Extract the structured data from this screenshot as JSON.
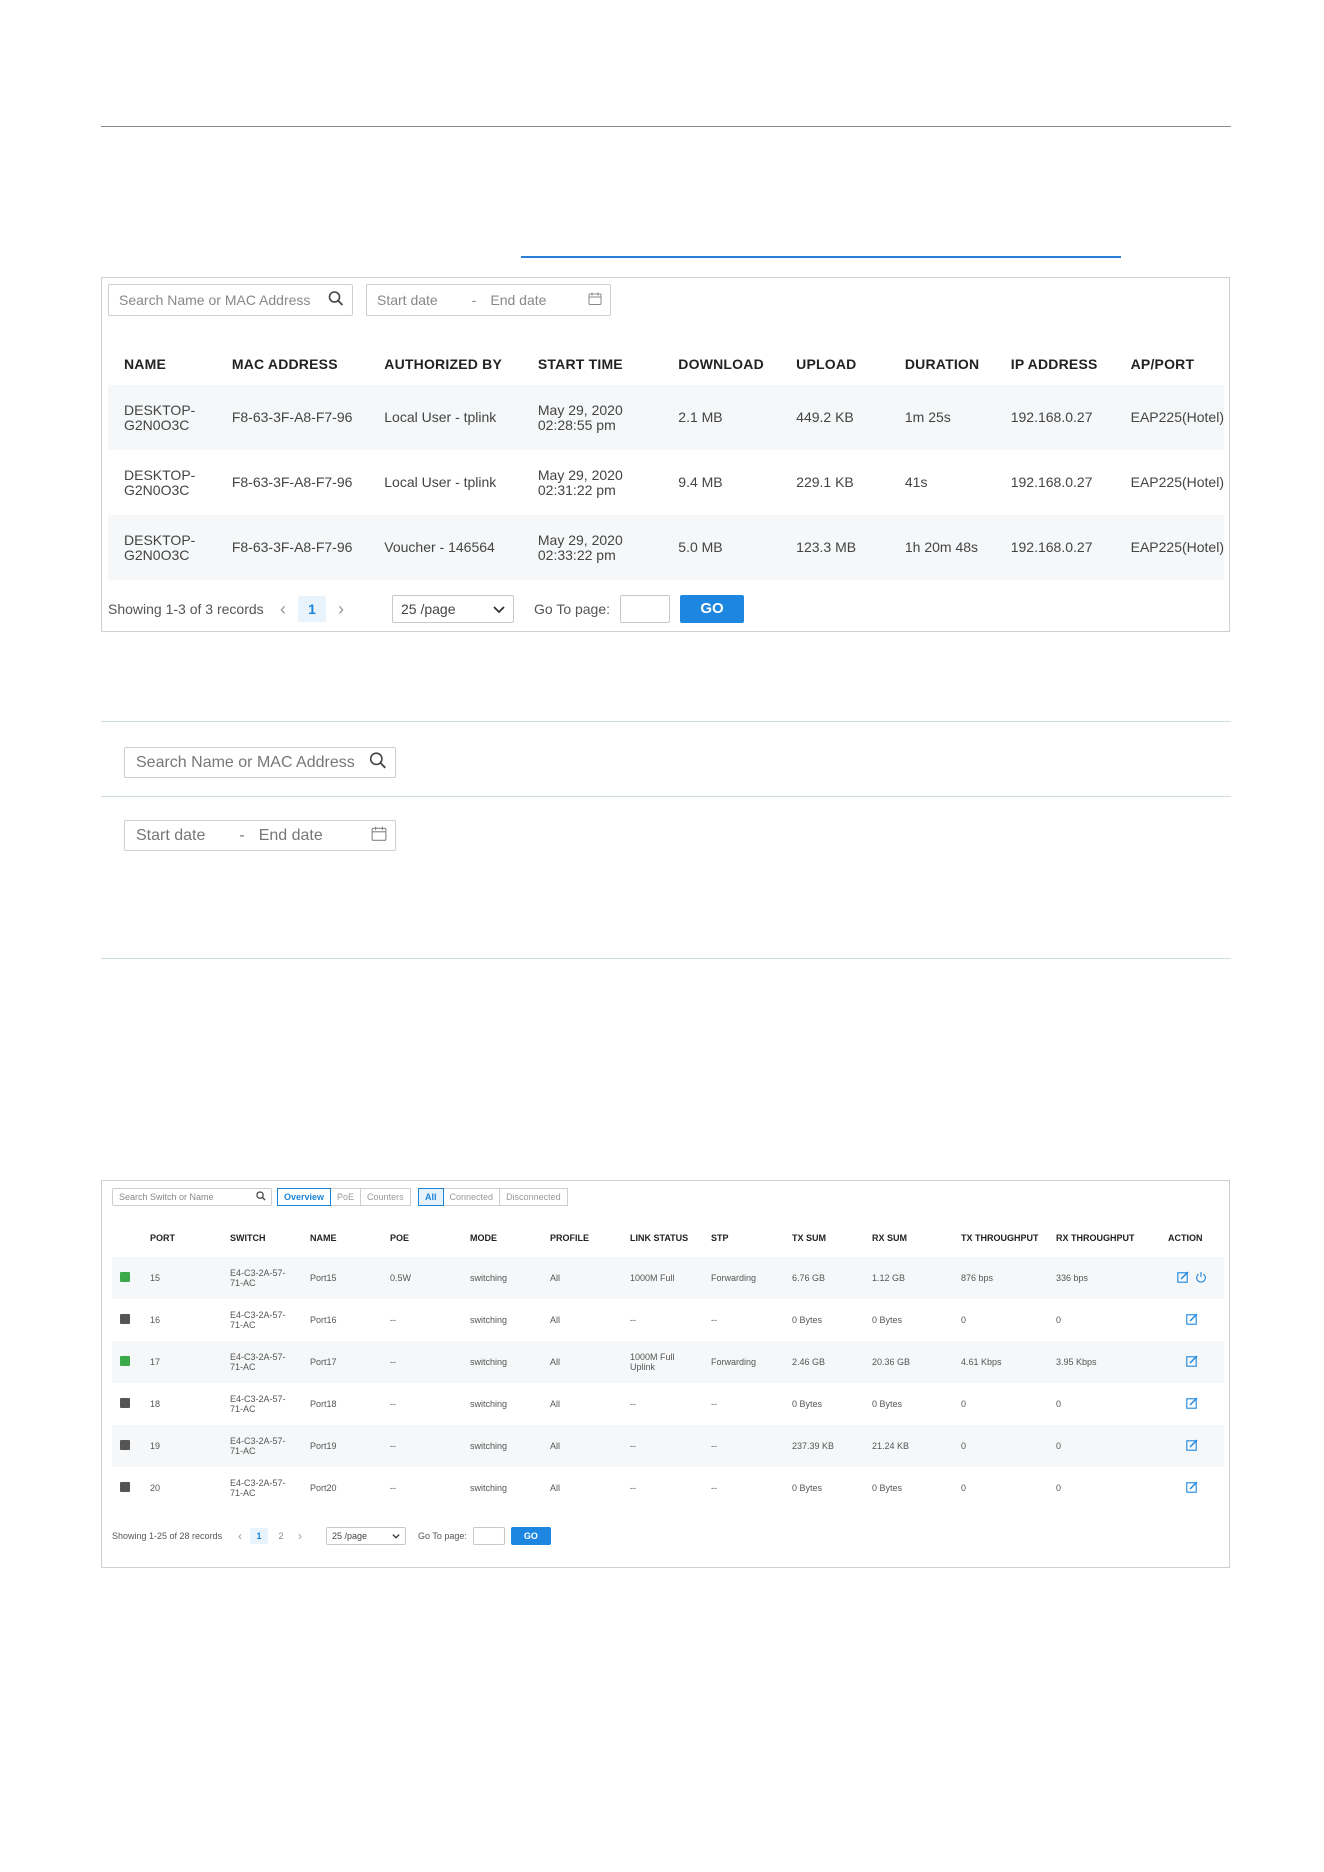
{
  "panel1": {
    "search_placeholder": "Search Name or MAC Address",
    "date_start": "Start date",
    "date_sep": "-",
    "date_end": "End date",
    "columns": [
      "NAME",
      "MAC ADDRESS",
      "AUTHORIZED BY",
      "START TIME",
      "DOWNLOAD",
      "UPLOAD",
      "DURATION",
      "IP ADDRESS",
      "AP/PORT"
    ],
    "rows": [
      {
        "name1": "DESKTOP-",
        "name2": "G2N0O3C",
        "mac": "F8-63-3F-A8-F7-96",
        "auth": "Local User - tplink",
        "time1": "May 29, 2020",
        "time2": "02:28:55 pm",
        "download": "2.1 MB",
        "upload": "449.2 KB",
        "duration": "1m 25s",
        "ip": "192.168.0.27",
        "ap": "EAP225(Hotel)"
      },
      {
        "name1": "DESKTOP-",
        "name2": "G2N0O3C",
        "mac": "F8-63-3F-A8-F7-96",
        "auth": "Local User - tplink",
        "time1": "May 29, 2020",
        "time2": "02:31:22 pm",
        "download": "9.4 MB",
        "upload": "229.1 KB",
        "duration": "41s",
        "ip": "192.168.0.27",
        "ap": "EAP225(Hotel)"
      },
      {
        "name1": "DESKTOP-",
        "name2": "G2N0O3C",
        "mac": "F8-63-3F-A8-F7-96",
        "auth": "Voucher - 146564",
        "time1": "May 29, 2020",
        "time2": "02:33:22 pm",
        "download": "5.0 MB",
        "upload": "123.3 MB",
        "duration": "1h 20m 48s",
        "ip": "192.168.0.27",
        "ap": "EAP225(Hotel)"
      }
    ],
    "pager": {
      "showing": "Showing 1-3 of 3 records",
      "page": "1",
      "per_page": "25 /page",
      "goto_label": "Go To page:",
      "go": "GO"
    }
  },
  "standalone": {
    "search_placeholder": "Search Name or MAC Address",
    "date_start": "Start date",
    "date_sep": "-",
    "date_end": "End date"
  },
  "panel2": {
    "search_placeholder": "Search Switch or Name",
    "view_tabs": [
      "Overview",
      "PoE",
      "Counters"
    ],
    "status_tabs": [
      "All",
      "Connected",
      "Disconnected"
    ],
    "columns": [
      "PORT",
      "SWITCH",
      "NAME",
      "POE",
      "MODE",
      "PROFILE",
      "LINK STATUS",
      "STP",
      "TX SUM",
      "RX SUM",
      "TX THROUGHPUT",
      "RX THROUGHPUT",
      "ACTION"
    ],
    "rows": [
      {
        "status": "up",
        "port": "15",
        "sw1": "E4-C3-2A-57-",
        "sw2": "71-AC",
        "name": "Port15",
        "poe": "0.5W",
        "mode": "switching",
        "profile": "All",
        "link1": "1000M Full",
        "link2": "",
        "stp": "Forwarding",
        "tx": "6.76 GB",
        "rx": "1.12 GB",
        "txt": "876 bps",
        "rxt": "336 bps",
        "power": true
      },
      {
        "status": "down",
        "port": "16",
        "sw1": "E4-C3-2A-57-",
        "sw2": "71-AC",
        "name": "Port16",
        "poe": "--",
        "mode": "switching",
        "profile": "All",
        "link1": "--",
        "link2": "",
        "stp": "--",
        "tx": "0 Bytes",
        "rx": "0 Bytes",
        "txt": "0",
        "rxt": "0",
        "power": false
      },
      {
        "status": "up",
        "port": "17",
        "sw1": "E4-C3-2A-57-",
        "sw2": "71-AC",
        "name": "Port17",
        "poe": "--",
        "mode": "switching",
        "profile": "All",
        "link1": "1000M Full",
        "link2": "Uplink",
        "stp": "Forwarding",
        "tx": "2.46 GB",
        "rx": "20.36 GB",
        "txt": "4.61 Kbps",
        "rxt": "3.95 Kbps",
        "power": false
      },
      {
        "status": "down",
        "port": "18",
        "sw1": "E4-C3-2A-57-",
        "sw2": "71-AC",
        "name": "Port18",
        "poe": "--",
        "mode": "switching",
        "profile": "All",
        "link1": "--",
        "link2": "",
        "stp": "--",
        "tx": "0 Bytes",
        "rx": "0 Bytes",
        "txt": "0",
        "rxt": "0",
        "power": false
      },
      {
        "status": "down",
        "port": "19",
        "sw1": "E4-C3-2A-57-",
        "sw2": "71-AC",
        "name": "Port19",
        "poe": "--",
        "mode": "switching",
        "profile": "All",
        "link1": "--",
        "link2": "",
        "stp": "--",
        "tx": "237.39 KB",
        "rx": "21.24 KB",
        "txt": "0",
        "rxt": "0",
        "power": false
      },
      {
        "status": "down",
        "port": "20",
        "sw1": "E4-C3-2A-57-",
        "sw2": "71-AC",
        "name": "Port20",
        "poe": "--",
        "mode": "switching",
        "profile": "All",
        "link1": "--",
        "link2": "",
        "stp": "--",
        "tx": "0 Bytes",
        "rx": "0 Bytes",
        "txt": "0",
        "rxt": "0",
        "power": false
      }
    ],
    "pager": {
      "showing": "Showing 1-25 of 28 records",
      "pages": [
        "1",
        "2"
      ],
      "per_page": "25 /page",
      "goto_label": "Go To page:",
      "go": "GO"
    }
  },
  "colors": {
    "accent": "#1c86e0",
    "port_up": "#3ca94a",
    "port_down": "#555555",
    "row_stripe": "#f5f7f8"
  },
  "icons": {
    "search": "search-icon",
    "calendar": "calendar-icon",
    "edit": "edit-icon",
    "power": "power-icon",
    "prev": "chevron-left-icon",
    "next": "chevron-right-icon",
    "dropdown": "chevron-down-icon"
  }
}
